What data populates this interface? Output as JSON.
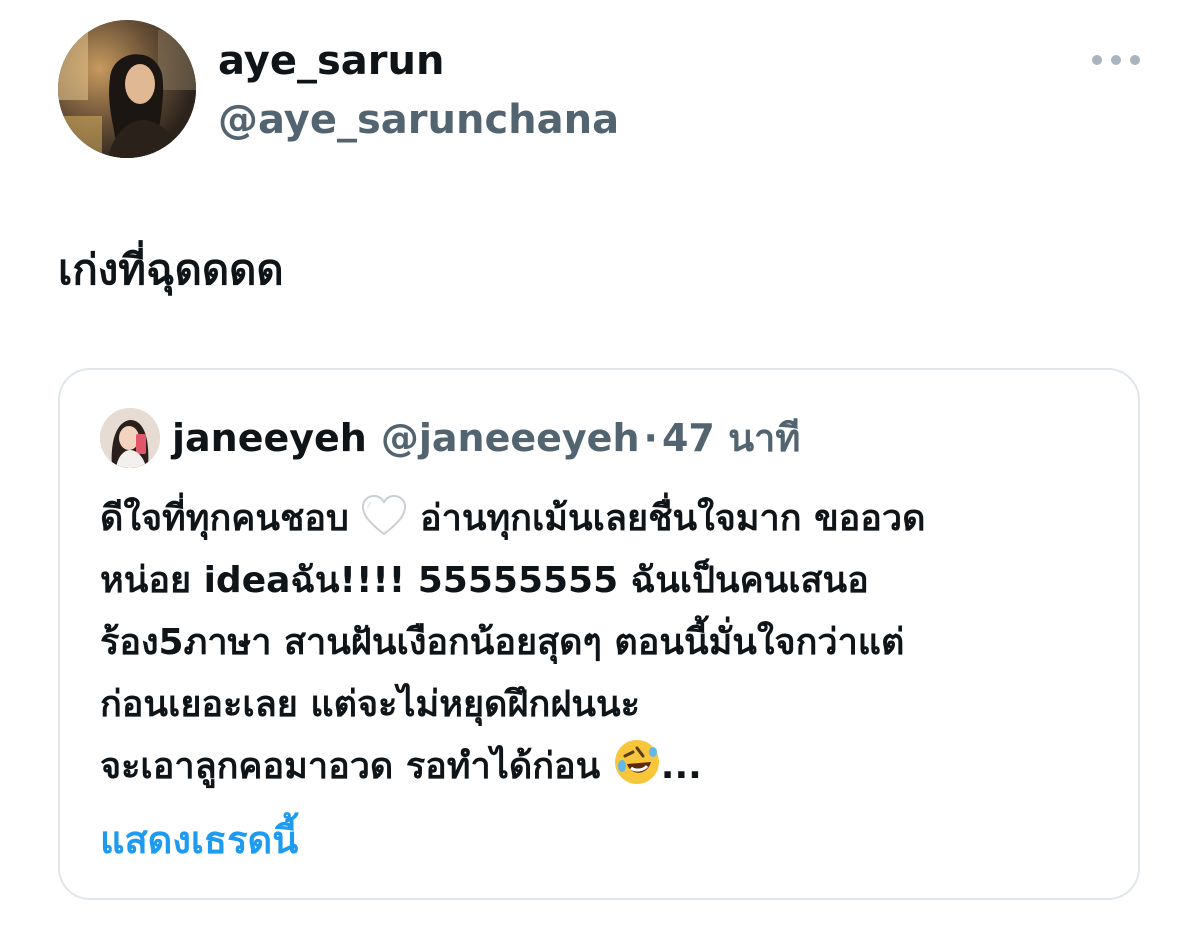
{
  "tweet": {
    "display_name": "aye_sarun",
    "handle": "@aye_sarunchana",
    "text": "เก่งที่ฉุดดดด",
    "more_icon": "more-horizontal-icon"
  },
  "quoted_tweet": {
    "display_name": "janeeyeh",
    "handle": "@janeeeyeh",
    "separator": "·",
    "time": "47 นาที",
    "body_lines": {
      "l1a": "ดีใจที่ทุกคนชอบ",
      "l1b": "อ่านทุกเม้นเลยชื่นใจมาก ขออวด",
      "l2": "หน่อย ideaฉัน!!!! 55555555 ฉันเป็นคนเสนอ",
      "l3": "ร้อง5ภาษา สานฝันเงือกน้อยสุดๆ ตอนนี้มั่นใจกว่าแต่",
      "l4": "ก่อนเยอะเลย แต่จะไม่หยุดฝึกฝนนะ",
      "l5a": "จะเอาลูกคอมาอวด รอทำได้ก่อน",
      "l5b": "..."
    },
    "emoji": [
      "white-heart-icon",
      "rolling-laughing-face-icon"
    ],
    "show_thread_label": "แสดงเธรดนี้"
  },
  "colors": {
    "text_primary": "#0f1419",
    "text_secondary": "#536471",
    "link_blue": "#1d9bf0",
    "border": "#e1e6ea"
  }
}
